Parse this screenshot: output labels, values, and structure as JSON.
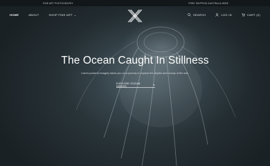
{
  "topbar": {
    "left_text": "Fine Art Photography",
    "right_text": "Free Shipping Australia Wide"
  },
  "nav": {
    "items": [
      {
        "label": "Home"
      },
      {
        "label": "About"
      },
      {
        "label": "Shop Fine Art"
      }
    ],
    "tools": {
      "search": "Search",
      "login": "Log in",
      "cart": "Cart (0)"
    }
  },
  "hero": {
    "title": "The Ocean Caught In Stillness",
    "subtitle": "Liam's powerful imagery takes you on a journey to explore the depths and beauty of the sea.",
    "cta": "Explore Ocean Series"
  },
  "colors": {
    "background": "#1c2529",
    "topbar": "#121719",
    "text": "#ffffff"
  },
  "icons": [
    "x-logo-icon",
    "search-icon",
    "user-icon",
    "cart-icon",
    "chevron-down-icon",
    "arrow-right-icon"
  ]
}
